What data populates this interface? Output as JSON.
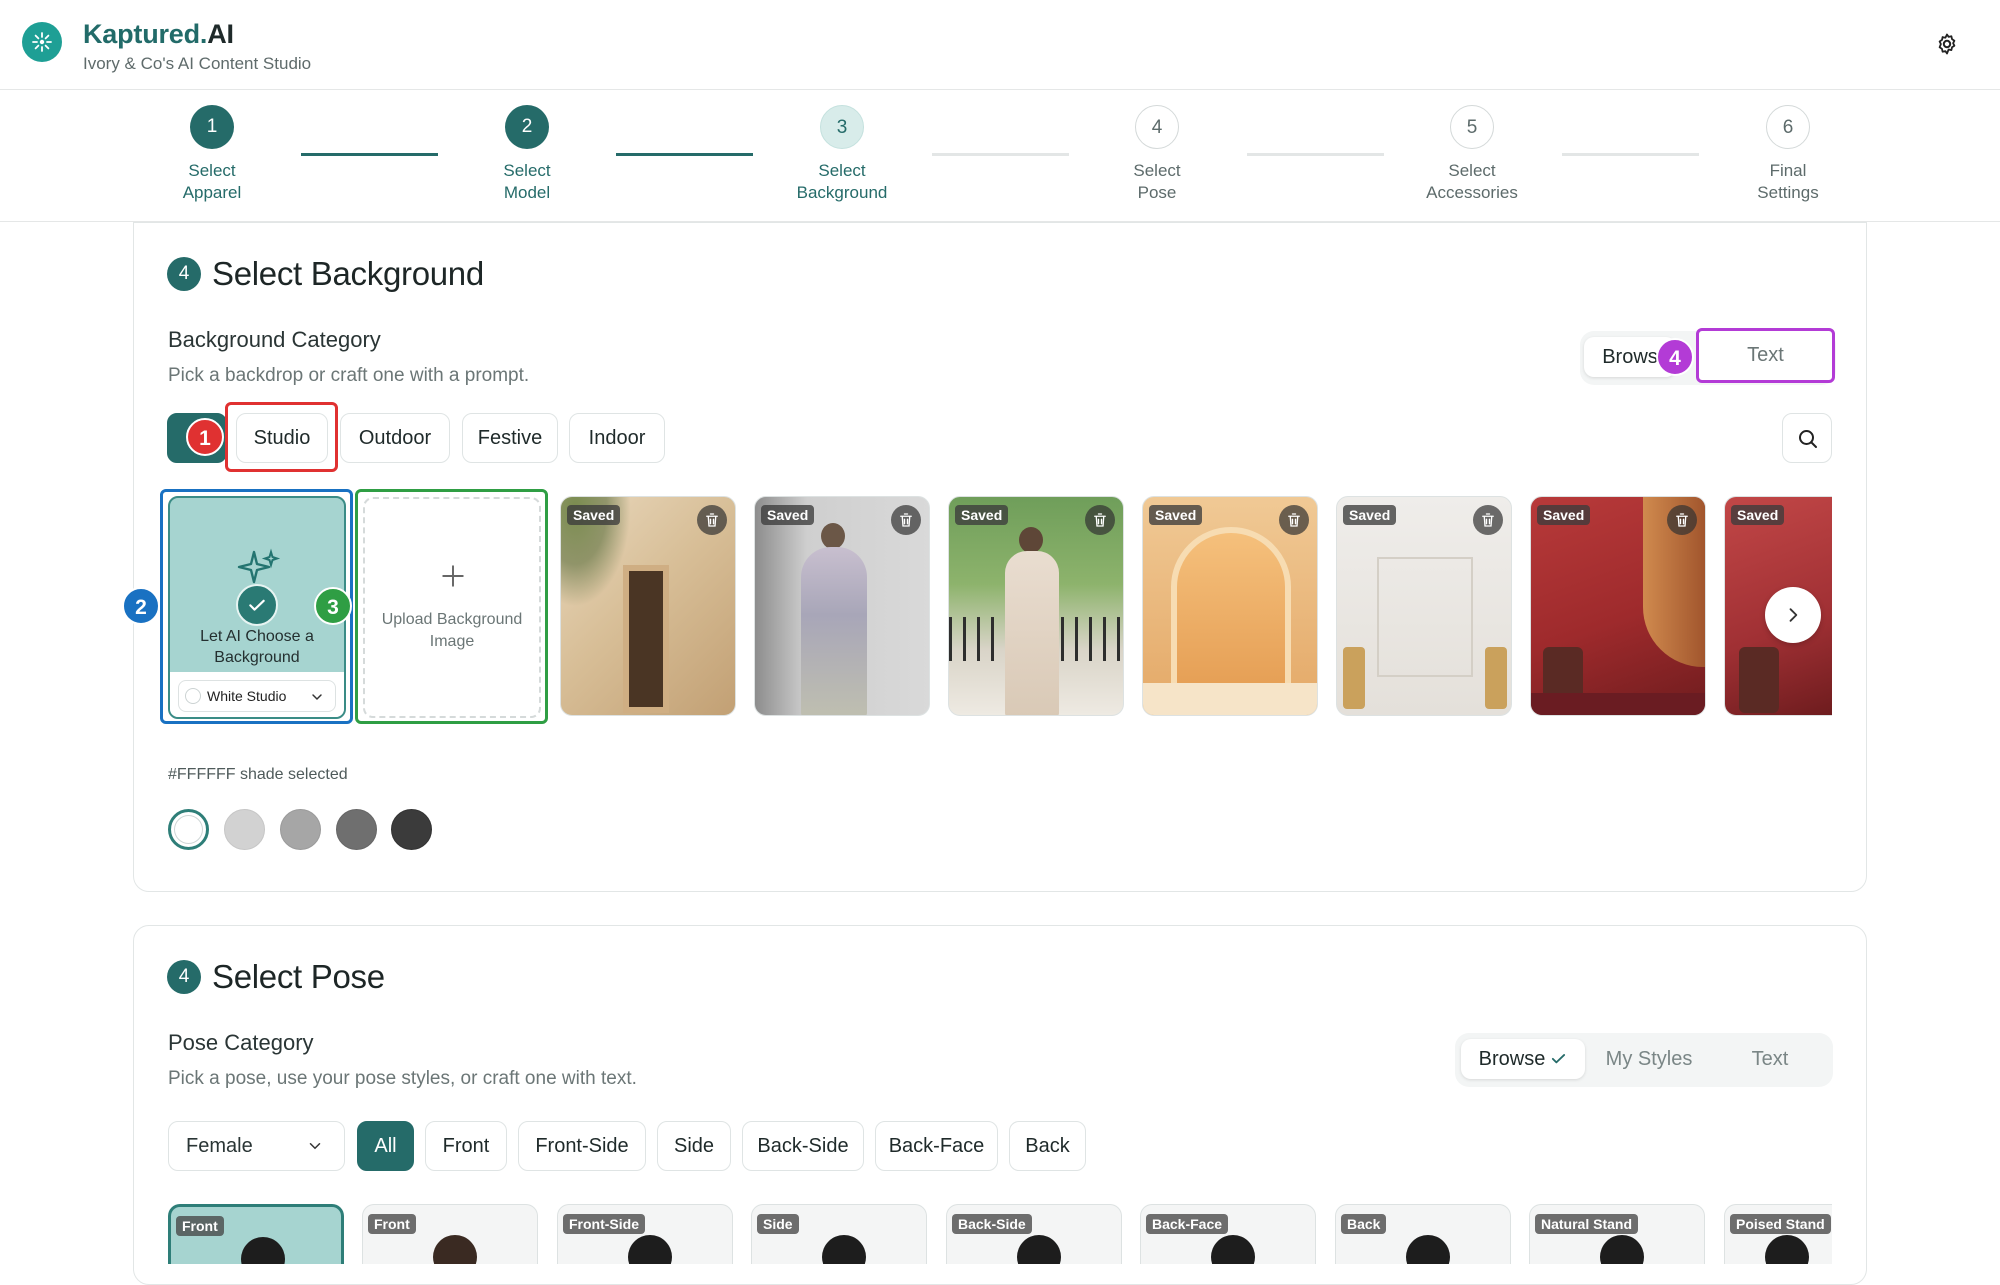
{
  "app": {
    "brand_main": "Kaptured.",
    "brand_ai": "AI",
    "subtitle": "Ivory & Co's AI Content Studio",
    "icons": {
      "logo": "sparkle-wand-icon",
      "settings": "gear-icon"
    }
  },
  "steps": [
    {
      "number": "1",
      "line1": "Select",
      "line2": "Apparel",
      "state": "done"
    },
    {
      "number": "2",
      "line1": "Select",
      "line2": "Model",
      "state": "done"
    },
    {
      "number": "3",
      "line1": "Select",
      "line2": "Background",
      "state": "current"
    },
    {
      "number": "4",
      "line1": "Select",
      "line2": "Pose",
      "state": "todo"
    },
    {
      "number": "5",
      "line1": "Select",
      "line2": "Accessories",
      "state": "todo"
    },
    {
      "number": "6",
      "line1": "Final",
      "line2": "Settings",
      "state": "todo"
    }
  ],
  "background_section": {
    "badge": "4",
    "title": "Select Background",
    "category_title": "Background Category",
    "category_desc": "Pick a backdrop or craft one with a prompt.",
    "mode_browse": "Brows",
    "mode_text": "Text",
    "chips": [
      "Studio",
      "Outdoor",
      "Festive",
      "Indoor"
    ],
    "ai_tile_label_line1": "Let AI Choose a",
    "ai_tile_label_line2": "Background",
    "ai_tile_dropdown": "White Studio",
    "upload_label_line1": "Upload Background",
    "upload_label_line2": "Image",
    "saved_label": "Saved",
    "shade_text": "#FFFFFF shade selected",
    "shades": [
      "#ffffff",
      "#d2d2d2",
      "#a6a6a6",
      "#6f6f6f",
      "#3b3b3b"
    ]
  },
  "annotations": [
    {
      "label": "1",
      "color": "#e03131"
    },
    {
      "label": "2",
      "color": "#1971c2"
    },
    {
      "label": "3",
      "color": "#2f9e44"
    },
    {
      "label": "4",
      "color": "#b33bd6"
    }
  ],
  "pose_section": {
    "badge": "4",
    "title": "Select Pose",
    "category_title": "Pose Category",
    "category_desc": "Pick a pose, use your pose styles, or craft one with text.",
    "mode_browse": "Browse",
    "mode_styles": "My Styles",
    "mode_text": "Text",
    "gender_select": "Female",
    "chips": [
      "All",
      "Front",
      "Front-Side",
      "Side",
      "Back-Side",
      "Back-Face",
      "Back"
    ],
    "tiles": [
      "Front",
      "Front",
      "Front-Side",
      "Side",
      "Back-Side",
      "Back-Face",
      "Back",
      "Natural Stand",
      "Poised Stand"
    ]
  },
  "colors": {
    "accent": "#256b69",
    "accent_light": "#d8ecea"
  }
}
